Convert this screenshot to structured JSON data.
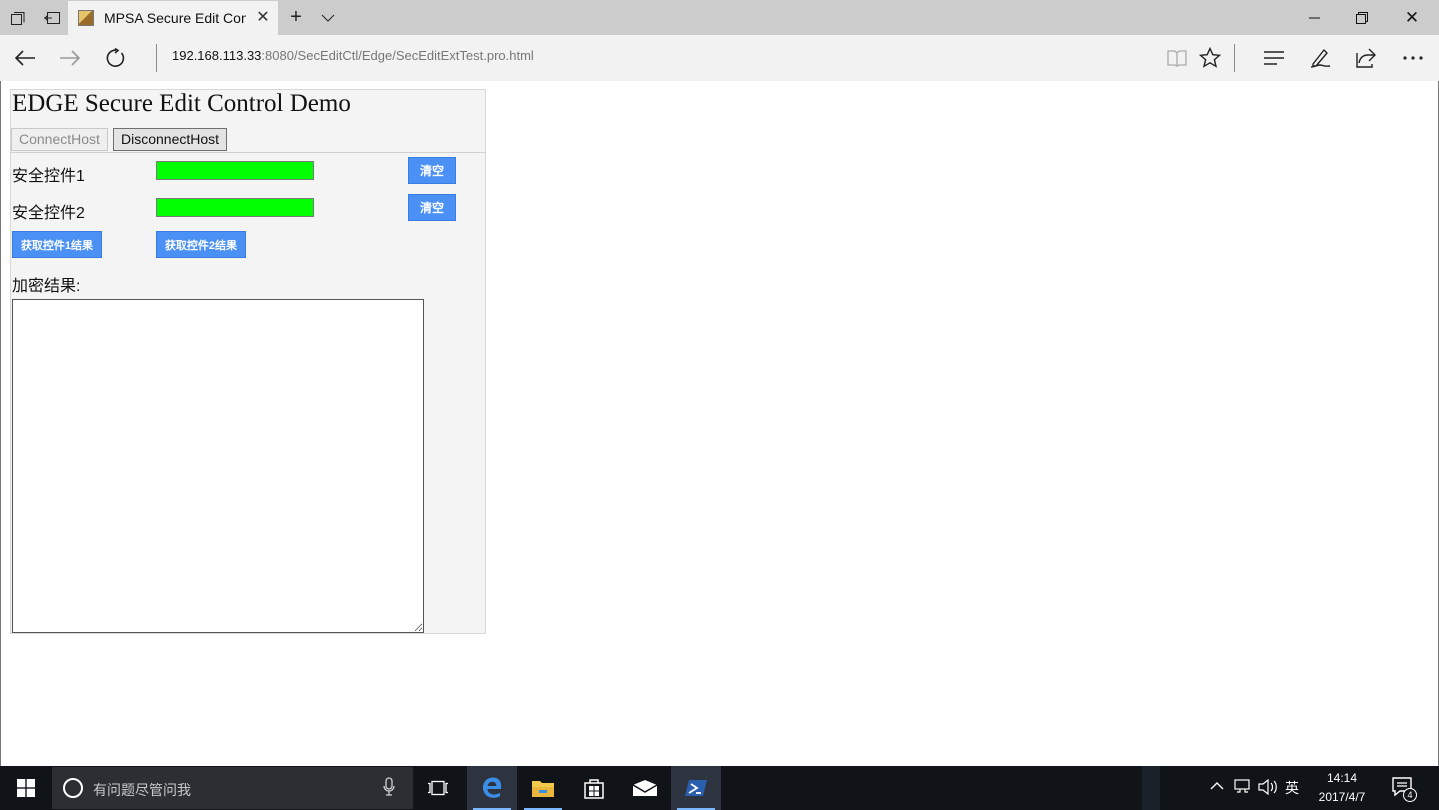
{
  "browser": {
    "tab_title": "MPSA Secure Edit Control Demo",
    "url_host": "192.168.113.33",
    "url_rest": ":8080/SecEditCtl/Edge/SecEditExtTest.pro.html",
    "icons": {
      "tab_actions": "tab-manager-icon",
      "set_aside": "set-aside-tabs-icon",
      "new_tab": "plus-icon",
      "tab_list": "chevron-down-icon",
      "minimize": "minimize-icon",
      "maximize": "restore-icon",
      "close": "close-icon",
      "back": "back-arrow-icon",
      "forward": "forward-arrow-icon",
      "refresh": "refresh-icon",
      "reading_view": "reading-view-icon",
      "favorite": "star-icon",
      "hub": "hub-icon",
      "notes": "pen-icon",
      "share": "share-icon",
      "more": "more-icon"
    }
  },
  "page": {
    "title": "EDGE Secure Edit Control Demo",
    "connect_label": "ConnectHost",
    "disconnect_label": "DisconnectHost",
    "control1_label": "安全控件1",
    "control2_label": "安全控件2",
    "clear_label": "清空",
    "get_result1_label": "获取控件1结果",
    "get_result2_label": "获取控件2结果",
    "result_label": "加密结果:",
    "result_value": "",
    "colors": {
      "field": "#00ff00",
      "button": "#4a90f5"
    }
  },
  "taskbar": {
    "search_placeholder": "有问题尽管问我",
    "ime_label": "英",
    "time": "14:14",
    "date": "2017/4/7",
    "notification_count": "4",
    "apps": [
      "task-view-icon",
      "edge-icon",
      "file-explorer-icon",
      "store-icon",
      "mail-icon",
      "powershell-icon"
    ]
  }
}
